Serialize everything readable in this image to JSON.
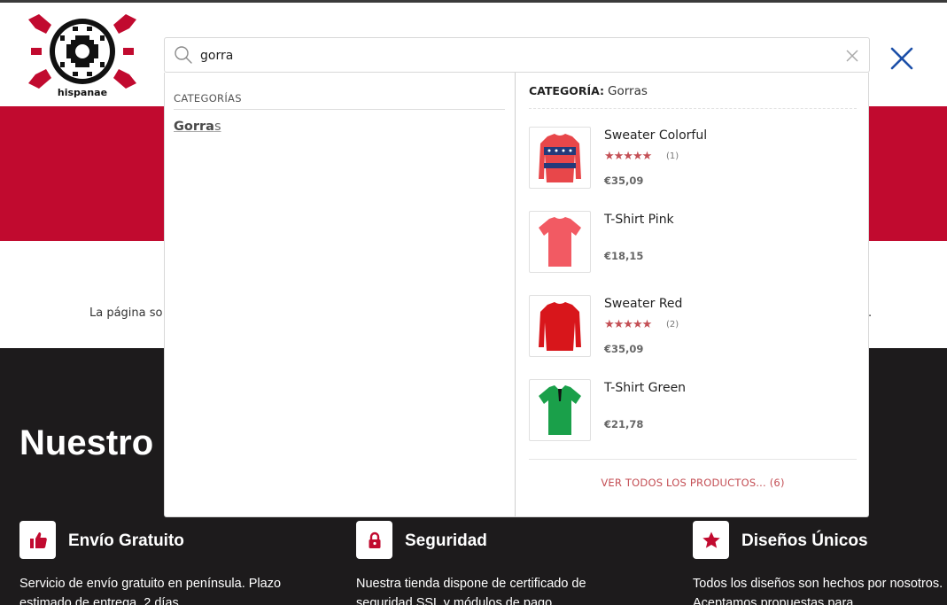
{
  "logo": {
    "text": "hispanae"
  },
  "search": {
    "value": "gorra",
    "placeholder": ""
  },
  "categories": {
    "heading": "CATEGORÍAS",
    "items": [
      {
        "match": "Gorra",
        "rest": "s"
      }
    ]
  },
  "products_panel": {
    "label": "CATEGORÍA:",
    "value": "Gorras",
    "items": [
      {
        "name": "Sweater Colorful",
        "stars": "★★★★★",
        "rating_count": "(1)",
        "price": "€35,09",
        "color": "#e8474a"
      },
      {
        "name": "T-Shirt Pink",
        "stars": "",
        "rating_count": "",
        "price": "€18,15",
        "color": "#f25a63"
      },
      {
        "name": "Sweater Red",
        "stars": "★★★★★",
        "rating_count": "(2)",
        "price": "€35,09",
        "color": "#d8161b"
      },
      {
        "name": "T-Shirt Green",
        "stars": "",
        "rating_count": "",
        "price": "€21,78",
        "color": "#1aa04a"
      }
    ],
    "view_all": "VER TODOS LOS PRODUCTOS... (6)"
  },
  "background": {
    "mid_text": "La página so",
    "mid_end": ".",
    "section_title": "Nuestro",
    "features": [
      {
        "icon": "thumbs-up-icon",
        "title": "Envío Gratuito",
        "text": "Servicio de envío gratuito en península. Plazo estimado de entrega, 2 días."
      },
      {
        "icon": "lock-icon",
        "title": "Seguridad",
        "text": "Nuestra tienda dispone de certificado de seguridad SSL y módulos de pago"
      },
      {
        "icon": "star-icon",
        "title": "Diseños Únicos",
        "text": "Todos los diseños son hechos por nosotros. Aceptamos propuestas para"
      }
    ]
  },
  "colors": {
    "brand_red": "#c10a2f",
    "dark": "#1d1b1c",
    "accent_blue": "#1c4fa8",
    "rating_red": "#c44f55"
  }
}
